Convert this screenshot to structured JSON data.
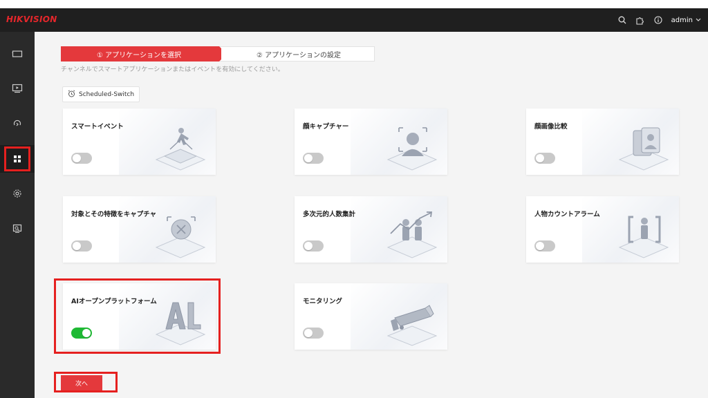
{
  "header": {
    "brand": "HIKVISION",
    "user": "admin"
  },
  "steps": [
    {
      "label": "① アプリケーションを選択",
      "active": true
    },
    {
      "label": "② アプリケーションの設定",
      "active": false
    }
  ],
  "hint": "チャンネルでスマートアプリケーションまたはイベントを有効にしてください。",
  "scheduled_switch": "Scheduled-Switch",
  "cards": [
    {
      "title": "スマートイベント",
      "enabled": false,
      "icon": "smart-event-icon"
    },
    {
      "title": "顔キャプチャー",
      "enabled": false,
      "icon": "face-capture-icon"
    },
    {
      "title": "顔画像比較",
      "enabled": false,
      "icon": "face-compare-icon"
    },
    {
      "title": "対象とその特徴をキャプチャ",
      "enabled": false,
      "icon": "target-capture-icon"
    },
    {
      "title": "多次元的人数集計",
      "enabled": false,
      "icon": "people-count-icon"
    },
    {
      "title": "人物カウントアラーム",
      "enabled": false,
      "icon": "person-alarm-icon"
    },
    {
      "title": "AIオープンプラットフォーム",
      "enabled": true,
      "icon": "ai-platform-icon"
    },
    {
      "title": "モニタリング",
      "enabled": false,
      "icon": "camera-icon"
    }
  ],
  "next_label": "次へ",
  "colors": {
    "accent": "#e4393c",
    "highlight": "#e5201f",
    "toggle_on": "#1fb934",
    "sidebar": "#2a2a2a",
    "topbar": "#1f1f1f"
  }
}
